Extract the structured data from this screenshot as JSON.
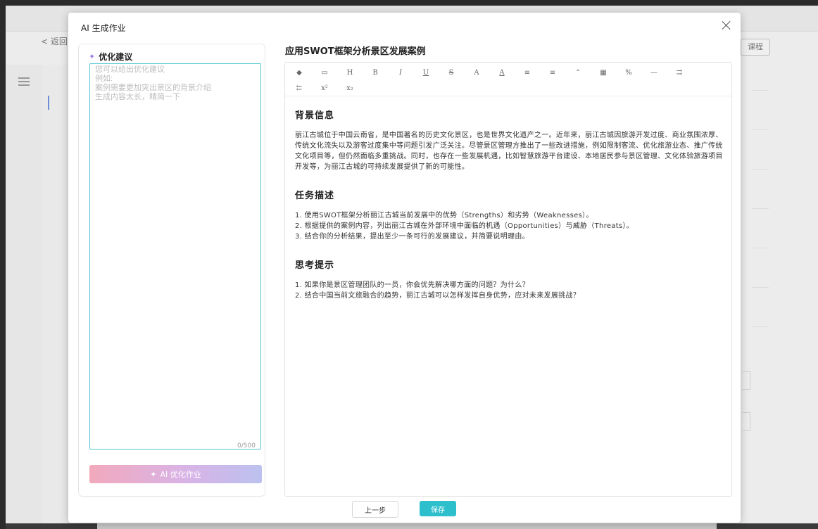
{
  "background": {
    "back_label": "< 返回",
    "right_button_label": "课程"
  },
  "modal": {
    "title": "AI 生成作业"
  },
  "suggestions": {
    "heading": "优化建议",
    "placeholder": "您可以给出优化建议\n例如:\n案例需要更加突出景区的背景介绍\n生成内容太长，精简一下",
    "value": "",
    "count": "0/500",
    "ai_button_label": "AI 优化作业"
  },
  "document": {
    "title": "应用SWOT框架分析景区发展案例",
    "toolbar_row1": [
      "eraser-icon",
      "code-block-icon",
      "heading-icon",
      "bold-icon",
      "italic-icon",
      "underline-icon",
      "strikethrough-icon",
      "font-color-icon",
      "bg-color-icon",
      "bullet-list-icon",
      "ordered-list-icon",
      "quote-icon",
      "table-icon",
      "link-icon",
      "hr-icon",
      "indent-icon"
    ],
    "toolbar_row2": [
      "outdent-icon",
      "superscript-icon",
      "subscript-icon"
    ],
    "sections": [
      {
        "heading": "背景信息",
        "lines": [
          "丽江古城位于中国云南省，是中国著名的历史文化景区，也是世界文化遗产之一。近年来，丽江古城因旅游开发过度、商业氛围浓厚、传统文化流失以及游客过度集中等问题引发广泛关注。尽管景区管理方推出了一些改进措施，例如限制客流、优化旅游业态、推广传统文化项目等，但仍然面临多重挑战。同时，也存在一些发展机遇，比如智慧旅游平台建设、本地居民参与景区管理、文化体验旅游项目开发等，为丽江古城的可持续发展提供了新的可能性。"
        ]
      },
      {
        "heading": "任务描述",
        "lines": [
          "1. 使用SWOT框架分析丽江古城当前发展中的优势（Strengths）和劣势（Weaknesses）。",
          "2. 根据提供的案例内容，列出丽江古城在外部环境中面临的机遇（Opportunities）与威胁（Threats）。",
          "3. 结合你的分析结果，提出至少一条可行的发展建议，并简要说明理由。"
        ]
      },
      {
        "heading": "思考提示",
        "lines": [
          "1. 如果你是景区管理团队的一员，你会优先解决哪方面的问题？为什么？",
          "2. 结合中国当前文旅融合的趋势，丽江古城可以怎样发挥自身优势，应对未来发展挑战？"
        ]
      }
    ]
  },
  "footer": {
    "prev_label": "上一步",
    "save_label": "保存"
  },
  "colors": {
    "accent": "#2ebfcc",
    "input_border": "#55c8d4",
    "ai_gradient_start": "#f2a9bc",
    "ai_gradient_end": "#bcc1ef"
  }
}
